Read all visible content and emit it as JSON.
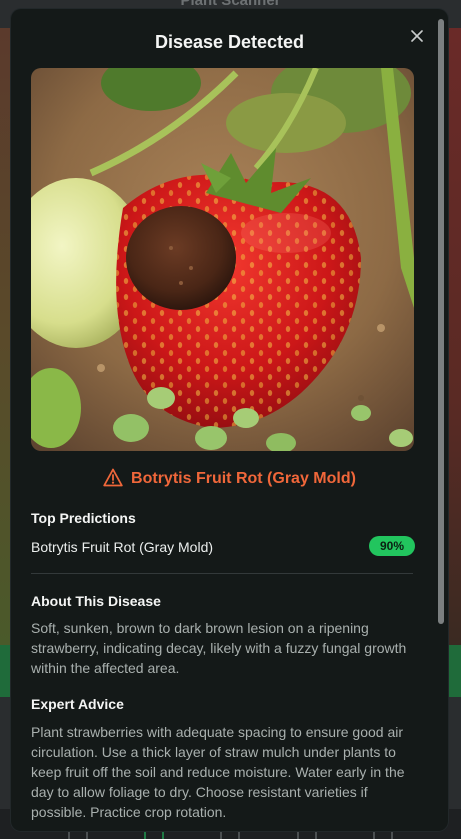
{
  "background": {
    "app_title": "Plant Scanner"
  },
  "modal": {
    "title": "Disease Detected",
    "close_label": "×",
    "image_alt": "strawberry-with-brown-lesion",
    "diagnosis": "Botrytis Fruit Rot (Gray Mold)",
    "top_predictions_title": "Top Predictions",
    "predictions": [
      {
        "name": "Botrytis Fruit Rot (Gray Mold)",
        "confidence": "90%"
      }
    ],
    "about_title": "About This Disease",
    "about_text": "Soft, sunken, brown to dark brown lesion on a ripening strawberry, indicating decay, likely with a fuzzy fungal growth within the affected area.",
    "advice_title": "Expert Advice",
    "advice_text": "Plant strawberries with adequate spacing to ensure good air circulation. Use a thick layer of straw mulch under plants to keep fruit off the soil and reduce moisture. Water early in the day to allow foliage to dry. Choose resistant varieties if possible. Practice crop rotation."
  },
  "colors": {
    "accent_warning": "#f0673a",
    "confidence_badge": "#22c55e",
    "modal_bg": "#141918"
  },
  "icons": [
    "close-icon",
    "warning-triangle-icon"
  ]
}
